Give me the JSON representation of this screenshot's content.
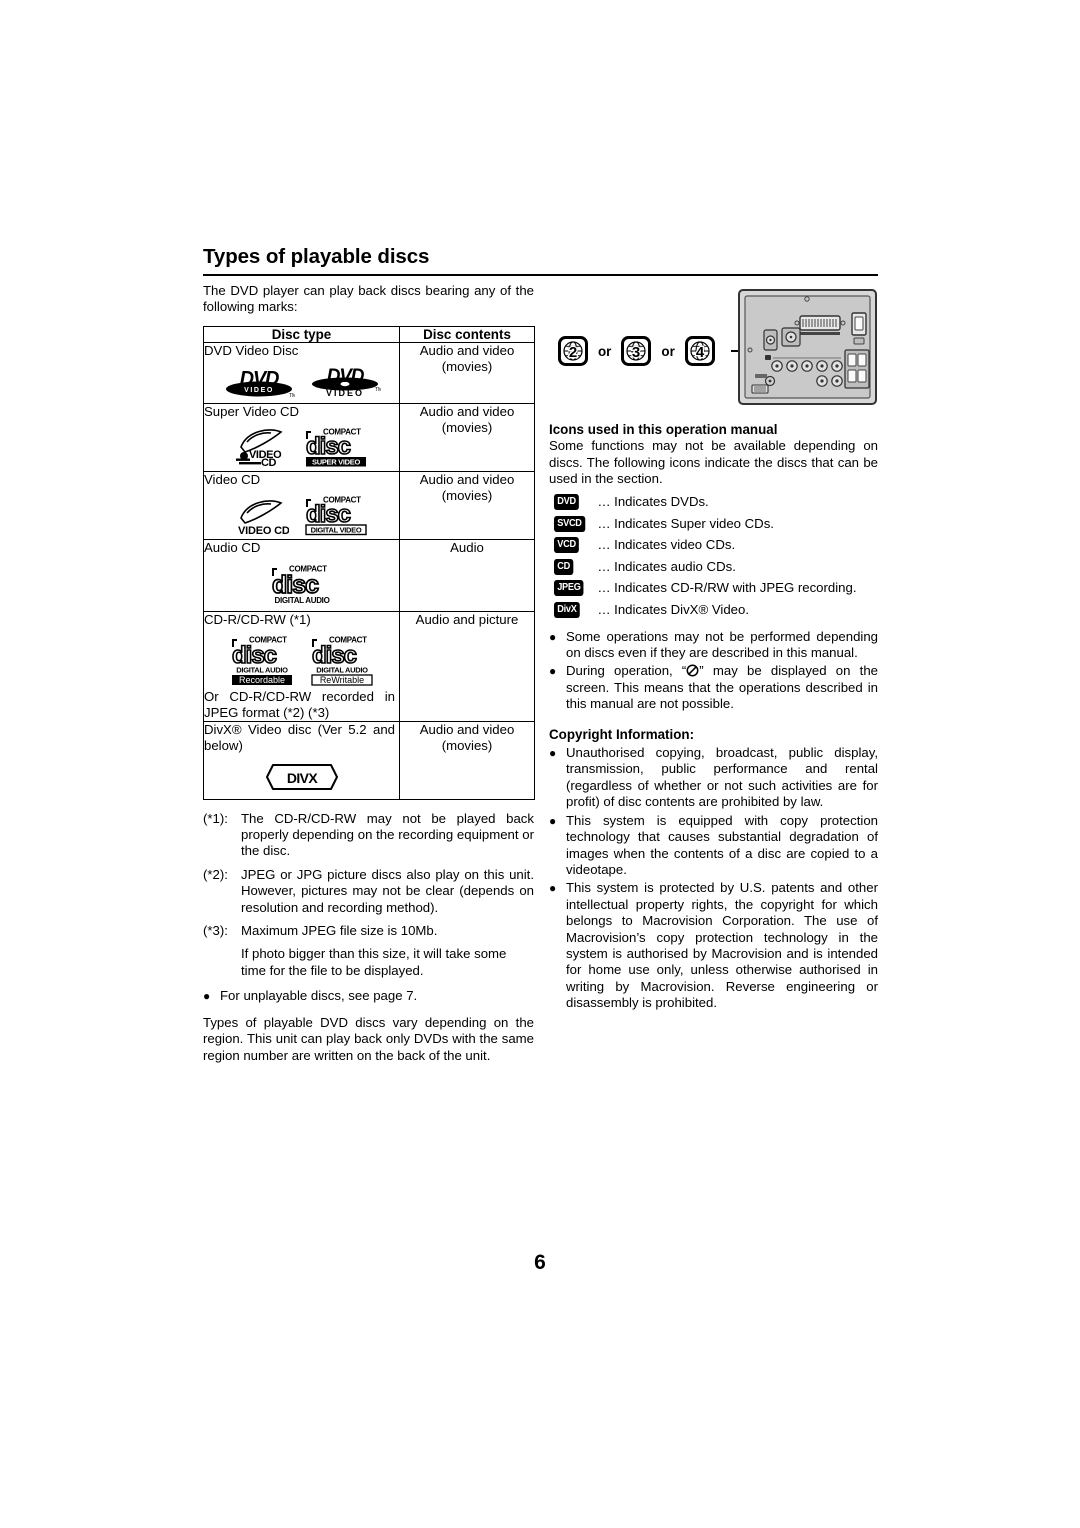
{
  "document": {
    "page_number": "6",
    "heading": "Types of playable discs",
    "intro": "The DVD player can play back discs bearing any of the following marks:"
  },
  "table": {
    "headers": [
      "Disc type",
      "Disc contents"
    ],
    "rows": [
      {
        "type_label": "DVD Video Disc",
        "contents": "Audio and video (movies)",
        "logos": [
          "dvd-video-logo-a",
          "dvd-video-logo-b"
        ]
      },
      {
        "type_label": "Super Video CD",
        "contents": "Audio and video (movies)",
        "logos": [
          "video-cd-swoosh-icon",
          "compact-disc-super-video-logo"
        ],
        "disc_sub": "SUPER VIDEO",
        "swoosh_text": "VIDEO CD"
      },
      {
        "type_label": "Video CD",
        "contents": "Audio and video (movies)",
        "logos": [
          "video-cd-swoosh-icon",
          "compact-disc-digital-video-logo"
        ],
        "disc_sub": "DIGITAL VIDEO",
        "swoosh_text": "VIDEO CD"
      },
      {
        "type_label": "Audio CD",
        "contents": "Audio",
        "logos": [
          "compact-disc-digital-audio-logo"
        ],
        "disc_sub": "DIGITAL AUDIO"
      },
      {
        "type_label": "CD-R/CD-RW (*1)",
        "type_label_2": "Or CD-R/CD-RW recorded in JPEG format (*2) (*3)",
        "contents": "Audio and picture",
        "logos": [
          "compact-disc-recordable-logo",
          "compact-disc-rewritable-logo"
        ],
        "disc_sub": "DIGITAL AUDIO",
        "tag_a": "Recordable",
        "tag_b": "ReWritable"
      },
      {
        "type_label": "DivX® Video disc (Ver 5.2 and below)",
        "contents": "Audio and video (movies)",
        "logos": [
          "divx-logo"
        ],
        "divx_text": "DIVX"
      }
    ]
  },
  "compact_word": "COMPACT",
  "disc_word": "disc",
  "footnotes": [
    {
      "tag": "(*1):",
      "text": "The CD-R/CD-RW may not be played back properly depending on the recording equipment or the disc."
    },
    {
      "tag": "(*2):",
      "text": "JPEG or JPG picture discs also play on this unit. However, pictures may not be clear (depends on resolution and recording method)."
    },
    {
      "tag": "(*3):",
      "text": "Maximum JPEG file size is 10Mb.",
      "sub": "If photo bigger than this size, it will take some time for the file to be displayed."
    }
  ],
  "left_bullet": "For unplayable discs, see page 7.",
  "left_tail": "Types of playable DVD discs vary depending on the region. This unit can play back only DVDs with the same region number are written on the back of the unit.",
  "region": {
    "codes": [
      "2",
      "3",
      "4"
    ],
    "separator": "or",
    "rear_panel_name": "rear-panel-illustration"
  },
  "icons_section": {
    "title": "Icons used in this operation manual",
    "intro": "Some functions may not be available depending on discs. The following icons indicate the discs that can be used in the section.",
    "entries": [
      {
        "badge": "DVD",
        "dots": "...",
        "text": "Indicates DVDs."
      },
      {
        "badge": "SVCD",
        "dots": "...",
        "text": "Indicates Super video CDs."
      },
      {
        "badge": "VCD",
        "dots": "...",
        "text": "Indicates video CDs."
      },
      {
        "badge": "CD",
        "dots": "...",
        "text": "Indicates audio CDs."
      },
      {
        "badge": "JPEG",
        "dots": "...",
        "text": "Indicates CD-R/RW with JPEG recording."
      },
      {
        "badge": "DivX",
        "dots": "...",
        "text": "Indicates DivX® Video."
      }
    ]
  },
  "right_bullets": [
    "Some operations may not be performed depending on discs even if they are described in this manual.",
    "During operation, “ ” may be displayed on the screen. This means that the operations described in this manual are not possible."
  ],
  "right_bullet_2_parts": {
    "before": "During operation, “",
    "after": "” may be displayed on the screen. This means that the operations described in this manual are not possible."
  },
  "copyright": {
    "title": "Copyright Information:",
    "items": [
      "Unauthorised copying, broadcast, public display, transmission, public performance and rental (regardless of whether or not such activities are for profit) of disc contents are prohibited by law.",
      "This system is equipped with copy protection technology that causes substantial degradation of images when the contents of a disc are copied to a videotape.",
      "This system is protected by U.S. patents and other intellectual property rights, the copyright for which belongs to Macrovision Corporation. The use of Macrovision’s copy protection technology in the system is authorised by Macrovision and is intended for home use only, unless otherwise authorised in writing by Macrovision. Reverse engineering or disassembly is prohibited."
    ]
  }
}
